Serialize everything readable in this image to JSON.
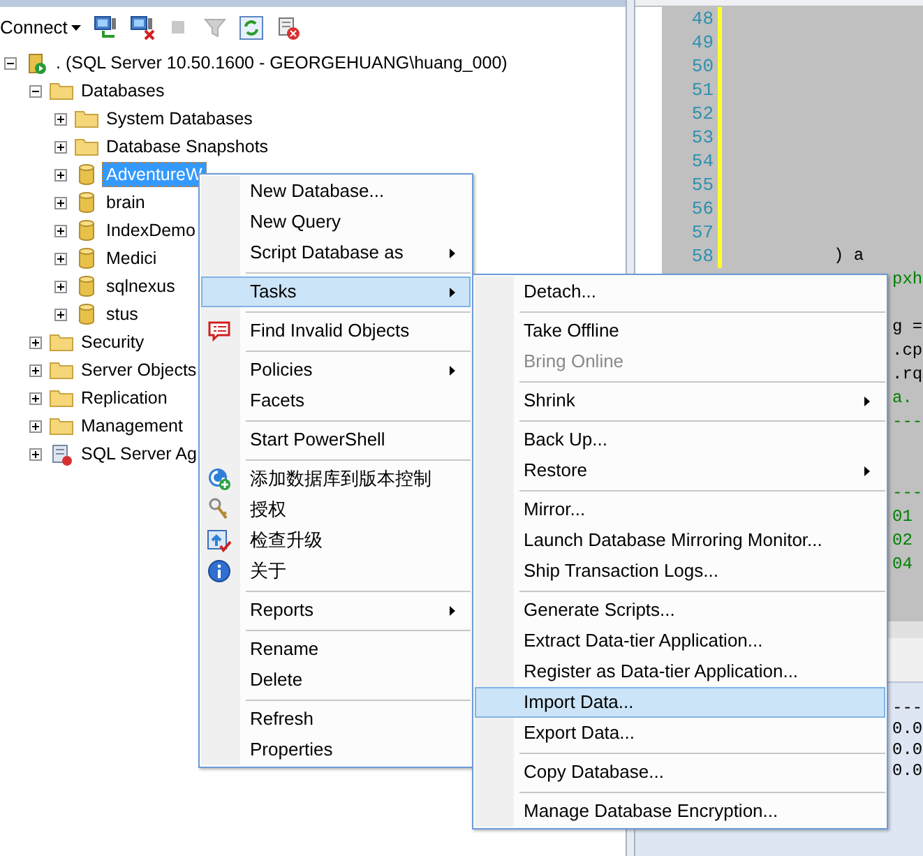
{
  "toolbar": {
    "connect": "Connect"
  },
  "tree": [
    {
      "label": ". (SQL Server 10.50.1600 - GEORGEHUANG\\huang_000)",
      "kind": "server",
      "expanded": true,
      "selected": false,
      "children": [
        {
          "label": "Databases",
          "kind": "folder",
          "expanded": true,
          "selected": false,
          "children": [
            {
              "label": "System Databases",
              "kind": "folder",
              "expanded": false,
              "selected": false
            },
            {
              "label": "Database Snapshots",
              "kind": "folder",
              "expanded": false,
              "selected": false
            },
            {
              "label": "AdventureW",
              "kind": "database",
              "expanded": false,
              "selected": true
            },
            {
              "label": "brain",
              "kind": "database",
              "expanded": false,
              "selected": false
            },
            {
              "label": "IndexDemo",
              "kind": "database",
              "expanded": false,
              "selected": false
            },
            {
              "label": "Medici",
              "kind": "database",
              "expanded": false,
              "selected": false
            },
            {
              "label": "sqlnexus",
              "kind": "database",
              "expanded": false,
              "selected": false
            },
            {
              "label": "stus",
              "kind": "database",
              "expanded": false,
              "selected": false
            }
          ]
        },
        {
          "label": "Security",
          "kind": "folder",
          "expanded": false,
          "selected": false
        },
        {
          "label": "Server Objects",
          "kind": "folder",
          "expanded": false,
          "selected": false
        },
        {
          "label": "Replication",
          "kind": "folder",
          "expanded": false,
          "selected": false
        },
        {
          "label": "Management",
          "kind": "folder",
          "expanded": false,
          "selected": false
        },
        {
          "label": "SQL Server Ag",
          "kind": "agent",
          "expanded": false,
          "selected": false
        }
      ]
    }
  ],
  "editor": {
    "rows": [
      {
        "kind": "numbered",
        "number": "48"
      },
      {
        "kind": "numbered",
        "number": "49"
      },
      {
        "kind": "numbered",
        "number": "50"
      },
      {
        "kind": "numbered",
        "number": "51"
      },
      {
        "kind": "numbered",
        "number": "52"
      },
      {
        "kind": "numbered",
        "number": "53"
      },
      {
        "kind": "numbered",
        "number": "54"
      },
      {
        "kind": "numbered",
        "number": "55"
      },
      {
        "kind": "numbered",
        "number": "56"
      },
      {
        "kind": "numbered",
        "number": "57"
      },
      {
        "kind": "numbered",
        "number": "58",
        "code": ") a",
        "color": "#000000"
      },
      {
        "kind": "code",
        "code": "pxh",
        "color": "#008000"
      },
      {
        "kind": "blank"
      },
      {
        "kind": "code",
        "code": "g =",
        "color": "#000000"
      },
      {
        "kind": "code",
        "code": ".cp",
        "color": "#000000"
      },
      {
        "kind": "code",
        "code": ".rq",
        "color": "#000000"
      },
      {
        "kind": "code",
        "code": "a.",
        "color": "#008000"
      },
      {
        "kind": "code",
        "code": "---",
        "color": "#008000"
      },
      {
        "kind": "blank"
      },
      {
        "kind": "blank"
      },
      {
        "kind": "code",
        "code": "---",
        "color": "#008000"
      },
      {
        "kind": "code",
        "code": "01",
        "color": "#008000"
      },
      {
        "kind": "code",
        "code": "02",
        "color": "#008000"
      },
      {
        "kind": "code",
        "code": "04",
        "color": "#008000"
      }
    ]
  },
  "results": {
    "rows": [
      "---",
      "0.0",
      "0.0",
      "0.0"
    ]
  },
  "context_menu": {
    "items": [
      {
        "kind": "item",
        "label": "New Database...",
        "submenu": false,
        "selected": false
      },
      {
        "kind": "item",
        "label": "New Query",
        "submenu": false,
        "selected": false
      },
      {
        "kind": "item",
        "label": "Script Database as",
        "submenu": true,
        "selected": false
      },
      {
        "kind": "separator"
      },
      {
        "kind": "item",
        "label": "Tasks",
        "submenu": true,
        "selected": true
      },
      {
        "kind": "separator"
      },
      {
        "kind": "icon_item",
        "label": "Find Invalid Objects",
        "submenu": false,
        "selected": false
      },
      {
        "kind": "separator"
      },
      {
        "kind": "item",
        "label": "Policies",
        "submenu": true,
        "selected": false
      },
      {
        "kind": "item",
        "label": "Facets",
        "submenu": false,
        "selected": false
      },
      {
        "kind": "separator"
      },
      {
        "kind": "item",
        "label": "Start PowerShell",
        "submenu": false,
        "selected": false
      },
      {
        "kind": "separator"
      },
      {
        "kind": "icon_item",
        "label": "添加数据库到版本控制",
        "submenu": false,
        "selected": false
      },
      {
        "kind": "icon_item",
        "label": "授权",
        "submenu": false,
        "selected": false
      },
      {
        "kind": "icon_item",
        "label": "检查升级",
        "submenu": false,
        "selected": false
      },
      {
        "kind": "icon_item",
        "label": "关于",
        "submenu": false,
        "selected": false
      },
      {
        "kind": "separator"
      },
      {
        "kind": "item",
        "label": "Reports",
        "submenu": true,
        "selected": false
      },
      {
        "kind": "separator"
      },
      {
        "kind": "item",
        "label": "Rename",
        "submenu": false,
        "selected": false
      },
      {
        "kind": "item",
        "label": "Delete",
        "submenu": false,
        "selected": false
      },
      {
        "kind": "separator"
      },
      {
        "kind": "item",
        "label": "Refresh",
        "submenu": false,
        "selected": false
      },
      {
        "kind": "item",
        "label": "Properties",
        "submenu": false,
        "selected": false
      }
    ]
  },
  "tasks_menu": {
    "items": [
      {
        "kind": "item",
        "label": "Detach...",
        "submenu": false,
        "selected": false,
        "disabled": false
      },
      {
        "kind": "separator"
      },
      {
        "kind": "item",
        "label": "Take Offline",
        "submenu": false,
        "selected": false,
        "disabled": false
      },
      {
        "kind": "item",
        "label": "Bring Online",
        "submenu": false,
        "selected": false,
        "disabled": true
      },
      {
        "kind": "separator"
      },
      {
        "kind": "item",
        "label": "Shrink",
        "submenu": true,
        "selected": false,
        "disabled": false
      },
      {
        "kind": "separator"
      },
      {
        "kind": "item",
        "label": "Back Up...",
        "submenu": false,
        "selected": false,
        "disabled": false
      },
      {
        "kind": "item",
        "label": "Restore",
        "submenu": true,
        "selected": false,
        "disabled": false
      },
      {
        "kind": "separator"
      },
      {
        "kind": "item",
        "label": "Mirror...",
        "submenu": false,
        "selected": false,
        "disabled": false
      },
      {
        "kind": "item",
        "label": "Launch Database Mirroring Monitor...",
        "submenu": false,
        "selected": false,
        "disabled": false
      },
      {
        "kind": "item",
        "label": "Ship Transaction Logs...",
        "submenu": false,
        "selected": false,
        "disabled": false
      },
      {
        "kind": "separator"
      },
      {
        "kind": "item",
        "label": "Generate Scripts...",
        "submenu": false,
        "selected": false,
        "disabled": false
      },
      {
        "kind": "item",
        "label": "Extract Data-tier Application...",
        "submenu": false,
        "selected": false,
        "disabled": false
      },
      {
        "kind": "item",
        "label": "Register as Data-tier Application...",
        "submenu": false,
        "selected": false,
        "disabled": false
      },
      {
        "kind": "item",
        "label": "Import Data...",
        "submenu": false,
        "selected": true,
        "disabled": false
      },
      {
        "kind": "item",
        "label": "Export Data...",
        "submenu": false,
        "selected": false,
        "disabled": false
      },
      {
        "kind": "separator"
      },
      {
        "kind": "item",
        "label": "Copy Database...",
        "submenu": false,
        "selected": false,
        "disabled": false
      },
      {
        "kind": "separator"
      },
      {
        "kind": "item",
        "label": "Manage Database Encryption...",
        "submenu": false,
        "selected": false,
        "disabled": false
      }
    ]
  }
}
